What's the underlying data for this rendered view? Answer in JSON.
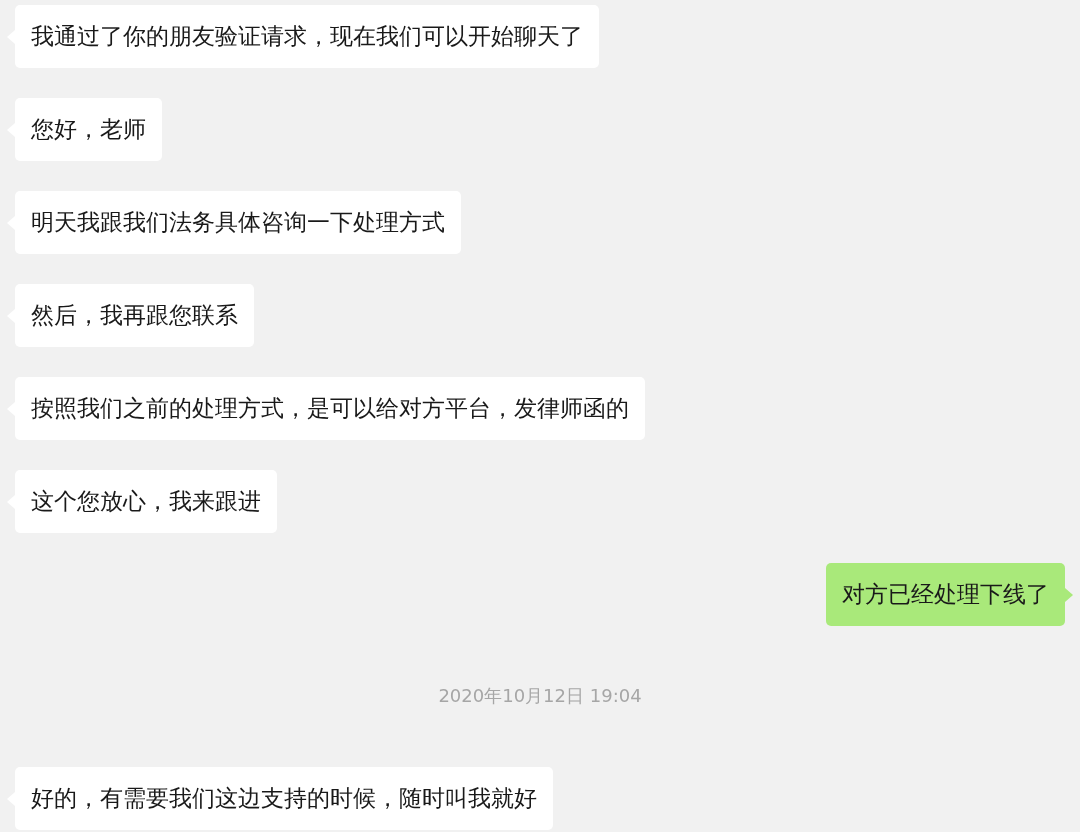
{
  "messages": [
    {
      "kind": "received",
      "text": "我通过了你的朋友验证请求，现在我们可以开始聊天了"
    },
    {
      "kind": "received",
      "text": "您好，老师"
    },
    {
      "kind": "received",
      "text": "明天我跟我们法务具体咨询一下处理方式"
    },
    {
      "kind": "received",
      "text": "然后，我再跟您联系"
    },
    {
      "kind": "received",
      "text": "按照我们之前的处理方式，是可以给对方平台，发律师函的"
    },
    {
      "kind": "received",
      "text": "这个您放心，我来跟进"
    },
    {
      "kind": "sent",
      "text": "对方已经处理下线了"
    },
    {
      "kind": "timestamp",
      "text": "2020年10月12日 19:04"
    },
    {
      "kind": "received",
      "text": "好的，有需要我们这边支持的时候，随时叫我就好"
    }
  ]
}
